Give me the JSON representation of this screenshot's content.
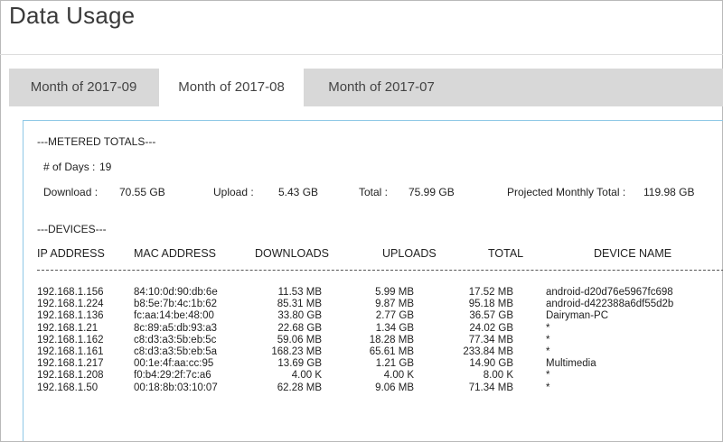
{
  "page": {
    "title": "Data Usage"
  },
  "tabs": [
    {
      "label": "Month of 2017-09"
    },
    {
      "label": "Month of 2017-08"
    },
    {
      "label": "Month of 2017-07"
    }
  ],
  "metered": {
    "heading": "---METERED TOTALS---",
    "days_label": "# of Days :",
    "days_value": "19",
    "download_label": "Download :",
    "download_value": "70.55 GB",
    "upload_label": "Upload :",
    "upload_value": "5.43 GB",
    "total_label": "Total :",
    "total_value": "75.99 GB",
    "projected_label": "Projected Monthly Total :",
    "projected_value": "119.98 GB"
  },
  "devices": {
    "heading": "---DEVICES---",
    "columns": [
      "IP ADDRESS",
      "MAC ADDRESS",
      "DOWNLOADS",
      "UPLOADS",
      "TOTAL",
      "DEVICE NAME"
    ],
    "rows": [
      {
        "ip": "192.168.1.156",
        "mac": "84:10:0d:90:db:6e",
        "dl": "11.53 MB",
        "ul": "5.99 MB",
        "total": "17.52 MB",
        "name": "android-d20d76e5967fc698"
      },
      {
        "ip": "192.168.1.224",
        "mac": "b8:5e:7b:4c:1b:62",
        "dl": "85.31 MB",
        "ul": "9.87 MB",
        "total": "95.18 MB",
        "name": "android-d422388a6df55d2b"
      },
      {
        "ip": "192.168.1.136",
        "mac": "fc:aa:14:be:48:00",
        "dl": "33.80 GB",
        "ul": "2.77 GB",
        "total": "36.57 GB",
        "name": "Dairyman-PC"
      },
      {
        "ip": "192.168.1.21",
        "mac": "8c:89:a5:db:93:a3",
        "dl": "22.68 GB",
        "ul": "1.34 GB",
        "total": "24.02 GB",
        "name": "*"
      },
      {
        "ip": "192.168.1.162",
        "mac": "c8:d3:a3:5b:eb:5c",
        "dl": "59.06 MB",
        "ul": "18.28 MB",
        "total": "77.34 MB",
        "name": "*"
      },
      {
        "ip": "192.168.1.161",
        "mac": "c8:d3:a3:5b:eb:5a",
        "dl": "168.23 MB",
        "ul": "65.61 MB",
        "total": "233.84 MB",
        "name": "*"
      },
      {
        "ip": "192.168.1.217",
        "mac": "00:1e:4f:aa:cc:95",
        "dl": "13.69 GB",
        "ul": "1.21 GB",
        "total": "14.90 GB",
        "name": "Multimedia"
      },
      {
        "ip": "192.168.1.208",
        "mac": "f0:b4:29:2f:7c:a6",
        "dl": "4.00 K",
        "ul": "4.00 K",
        "total": "8.00 K",
        "name": "*"
      },
      {
        "ip": "192.168.1.50",
        "mac": "00:18:8b:03:10:07",
        "dl": "62.28 MB",
        "ul": "9.06 MB",
        "total": "71.34 MB",
        "name": "*"
      }
    ]
  }
}
